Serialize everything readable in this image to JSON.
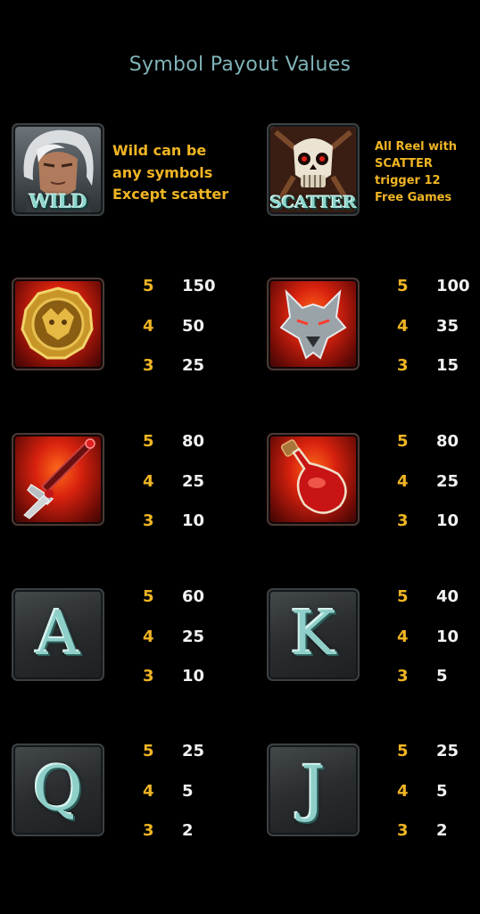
{
  "title": "Symbol Payout Values",
  "wild": {
    "badge": "WILD",
    "lines": [
      "Wild can be",
      "any symbols",
      "Except scatter"
    ]
  },
  "scatter": {
    "badge": "SCATTER",
    "lines": [
      "All Reel with",
      "SCATTER",
      "trigger 12",
      "Free Games"
    ]
  },
  "symbols": [
    {
      "icon": "golden-dragon-medallion-icon",
      "payouts": [
        {
          "count": "5",
          "amount": "150"
        },
        {
          "count": "4",
          "amount": "50"
        },
        {
          "count": "3",
          "amount": "25"
        }
      ]
    },
    {
      "icon": "wolf-head-icon",
      "payouts": [
        {
          "count": "5",
          "amount": "100"
        },
        {
          "count": "4",
          "amount": "35"
        },
        {
          "count": "3",
          "amount": "15"
        }
      ]
    },
    {
      "icon": "sword-icon",
      "payouts": [
        {
          "count": "5",
          "amount": "80"
        },
        {
          "count": "4",
          "amount": "25"
        },
        {
          "count": "3",
          "amount": "10"
        }
      ]
    },
    {
      "icon": "red-potion-icon",
      "payouts": [
        {
          "count": "5",
          "amount": "80"
        },
        {
          "count": "4",
          "amount": "25"
        },
        {
          "count": "3",
          "amount": "10"
        }
      ]
    },
    {
      "icon": "letter-a-icon",
      "letter": "A",
      "payouts": [
        {
          "count": "5",
          "amount": "60"
        },
        {
          "count": "4",
          "amount": "25"
        },
        {
          "count": "3",
          "amount": "10"
        }
      ]
    },
    {
      "icon": "letter-k-icon",
      "letter": "K",
      "payouts": [
        {
          "count": "5",
          "amount": "40"
        },
        {
          "count": "4",
          "amount": "10"
        },
        {
          "count": "3",
          "amount": "5"
        }
      ]
    },
    {
      "icon": "letter-q-icon",
      "letter": "Q",
      "payouts": [
        {
          "count": "5",
          "amount": "25"
        },
        {
          "count": "4",
          "amount": "5"
        },
        {
          "count": "3",
          "amount": "2"
        }
      ]
    },
    {
      "icon": "letter-j-icon",
      "letter": "J",
      "payouts": [
        {
          "count": "5",
          "amount": "25"
        },
        {
          "count": "4",
          "amount": "5"
        },
        {
          "count": "3",
          "amount": "2"
        }
      ]
    }
  ],
  "colors": {
    "title": "#7fb3b8",
    "count": "#f0b524",
    "amount": "#f2f2f2",
    "description": "#f0b524"
  }
}
